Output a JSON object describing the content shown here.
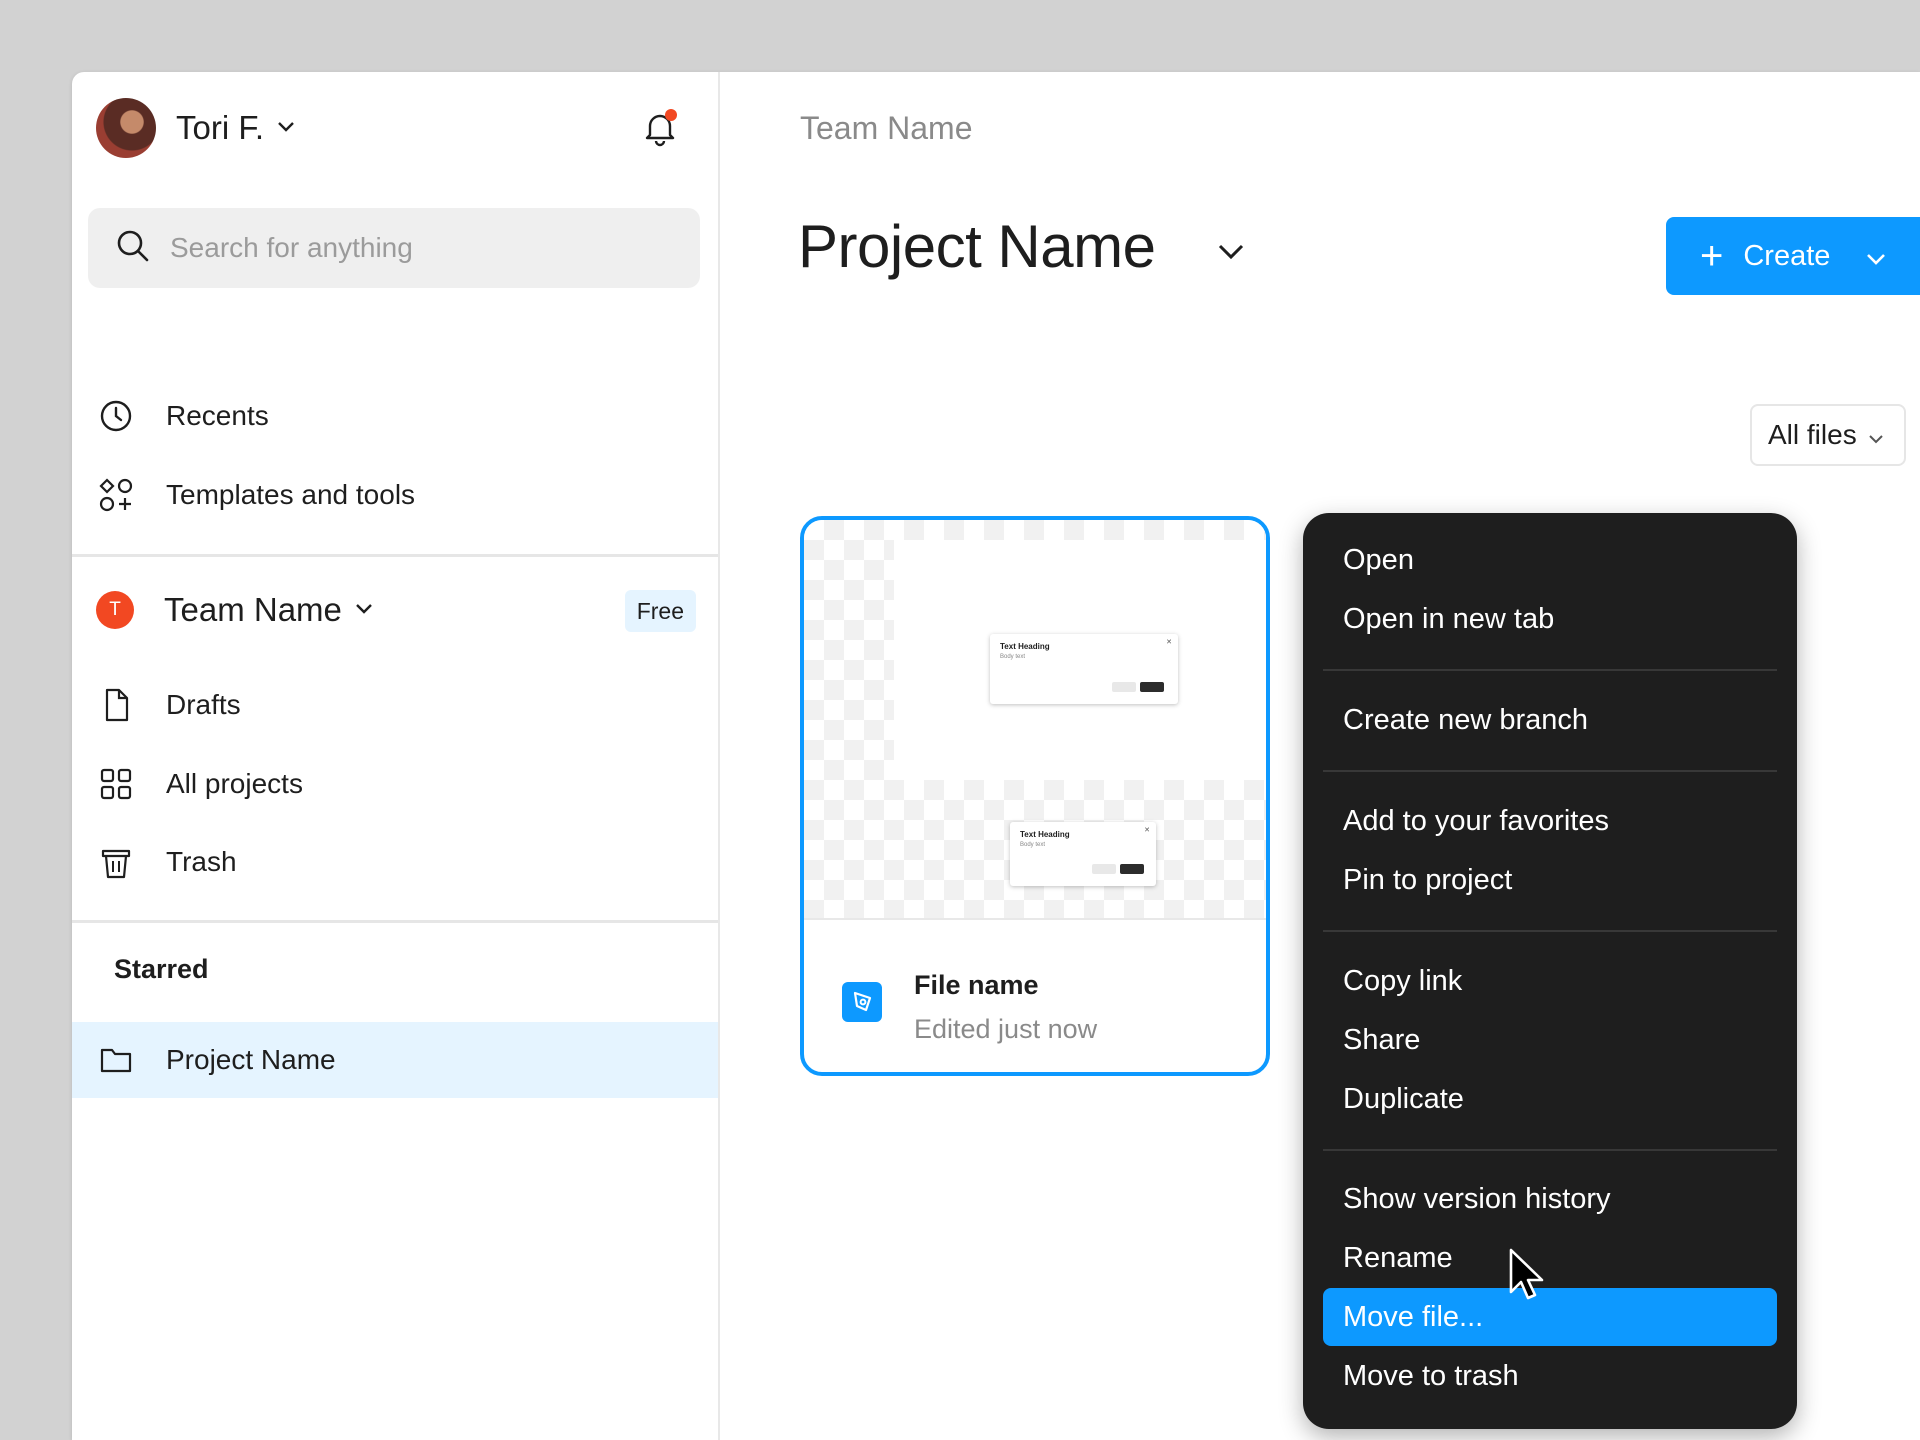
{
  "sidebar": {
    "user": {
      "name": "Tori F."
    },
    "search": {
      "placeholder": "Search for anything"
    },
    "nav": {
      "recents": "Recents",
      "templates": "Templates and tools"
    },
    "team": {
      "initial": "T",
      "name": "Team Name",
      "plan_badge": "Free"
    },
    "team_nav": {
      "drafts": "Drafts",
      "all_projects": "All projects",
      "trash": "Trash"
    },
    "starred": {
      "title": "Starred",
      "items": [
        {
          "label": "Project Name"
        }
      ]
    }
  },
  "main": {
    "breadcrumb": "Team Name",
    "title": "Project Name",
    "create_label": "Create",
    "filter_label": "All files",
    "file_card": {
      "name": "File name",
      "edited": "Edited just now",
      "thumbnail": {
        "heading": "Text Heading",
        "body": "Body text"
      }
    }
  },
  "context_menu": {
    "groups": [
      [
        {
          "label": "Open"
        },
        {
          "label": "Open in new tab"
        }
      ],
      [
        {
          "label": "Create new branch"
        }
      ],
      [
        {
          "label": "Add to your favorites"
        },
        {
          "label": "Pin to project"
        }
      ],
      [
        {
          "label": "Copy link"
        },
        {
          "label": "Share"
        },
        {
          "label": "Duplicate"
        }
      ],
      [
        {
          "label": "Show version history"
        },
        {
          "label": "Rename"
        },
        {
          "label": "Move file...",
          "active": true
        },
        {
          "label": "Move to trash"
        }
      ]
    ]
  },
  "colors": {
    "accent": "#0d99ff",
    "menu_bg": "#1e1e1e",
    "team_badge": "#f24822",
    "notification_dot": "#f24822",
    "selected_bg": "#e5f4ff"
  },
  "icons": {
    "notification": "bell-icon",
    "search": "search-icon",
    "recents": "clock-icon",
    "templates": "shapes-plus-icon",
    "drafts": "file-icon",
    "all_projects": "grid-icon",
    "trash": "trash-icon",
    "starred_item": "folder-icon",
    "file_type": "pen-tool-icon"
  }
}
